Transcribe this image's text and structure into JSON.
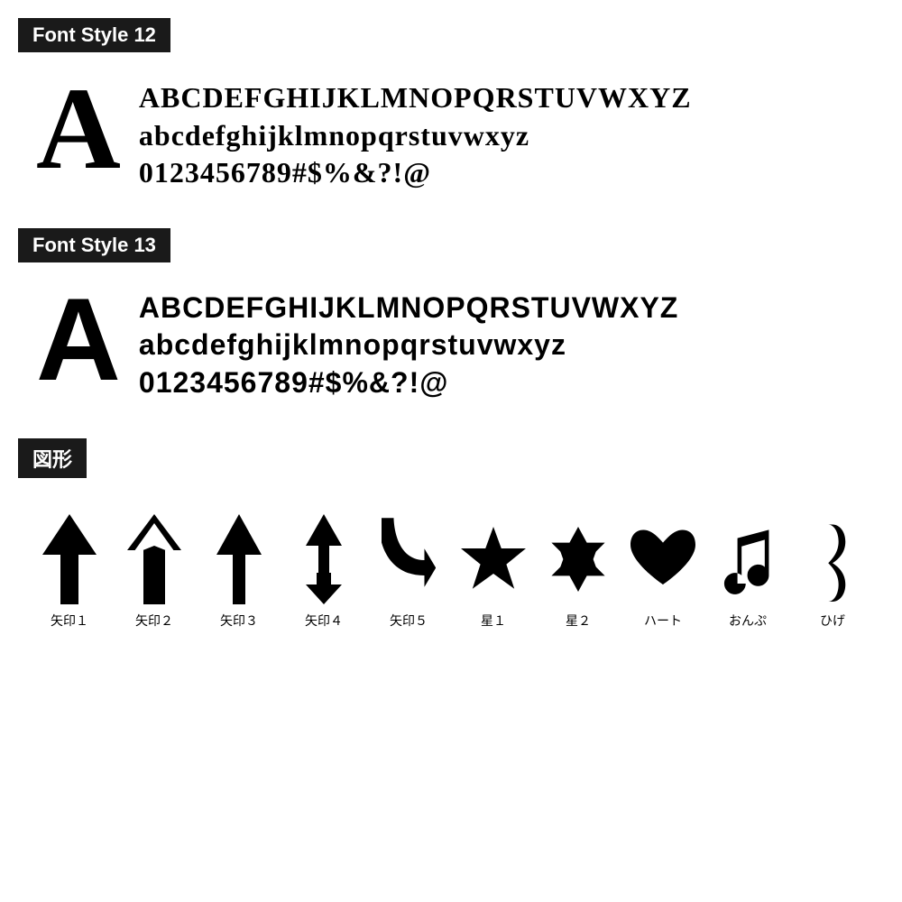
{
  "sections": [
    {
      "id": "font-style-12",
      "header": "Font Style 12",
      "big_letter": "A",
      "lines": [
        "ABCDEFGHIJKLMNOPQRSTUVWXYZ",
        "abcdefghijklmnopqrstuvwxyz",
        "0123456789#$%&?!@"
      ],
      "style_class": "style12"
    },
    {
      "id": "font-style-13",
      "header": "Font Style 13",
      "big_letter": "A",
      "lines": [
        "ABCDEFGHIJKLMNOPQRSTUVWXYZ",
        "abcdefghijklmnopqrstuvwxyz",
        "0123456789#$%&?!@"
      ],
      "style_class": "style13"
    }
  ],
  "shapes_section": {
    "header": "図形",
    "shapes": [
      {
        "id": "yazirushi1",
        "label": "矢印１"
      },
      {
        "id": "yazirushi2",
        "label": "矢印２"
      },
      {
        "id": "yazirushi3",
        "label": "矢印３"
      },
      {
        "id": "yazirushi4",
        "label": "矢印４"
      },
      {
        "id": "yazirushi5",
        "label": "矢印５"
      },
      {
        "id": "hoshi1",
        "label": "星１"
      },
      {
        "id": "hoshi2",
        "label": "星２"
      },
      {
        "id": "heart",
        "label": "ハート"
      },
      {
        "id": "onpu",
        "label": "おんぷ"
      },
      {
        "id": "hige",
        "label": "ひげ"
      }
    ]
  }
}
